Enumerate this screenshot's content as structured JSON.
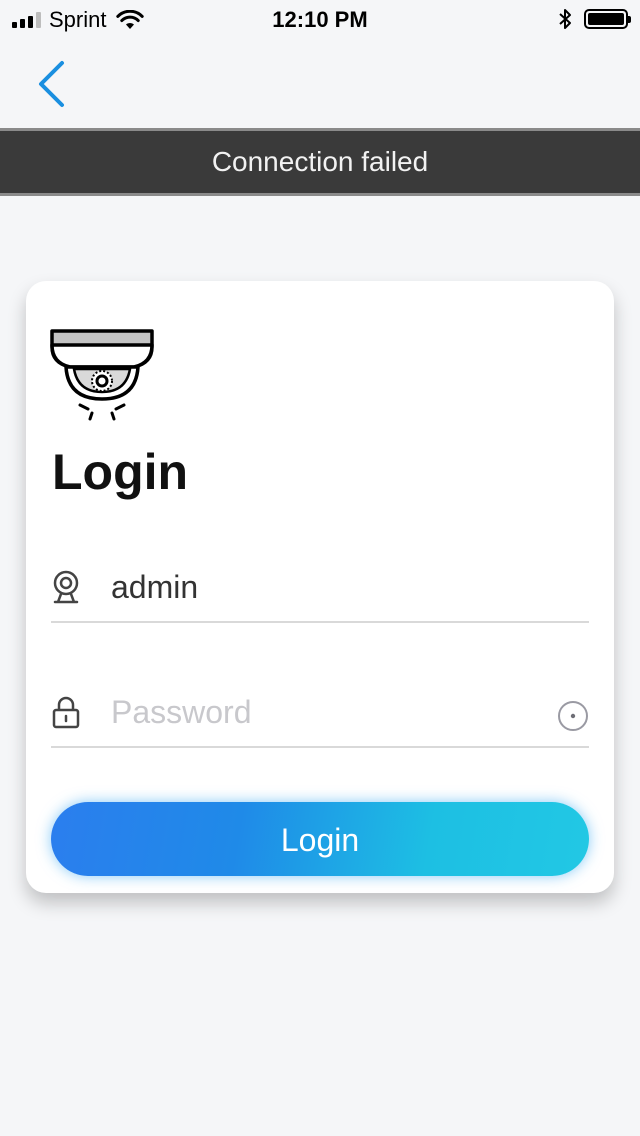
{
  "status_bar": {
    "carrier": "Sprint",
    "time": "12:10 PM",
    "signal_bars_filled": 3,
    "signal_bars_total": 4
  },
  "nav": {
    "back_icon": "chevron-left-icon",
    "accent_color": "#1a8fe0"
  },
  "banner": {
    "message": "Connection failed"
  },
  "login_card": {
    "logo_icon": "dome-camera-icon",
    "title": "Login",
    "username": {
      "icon": "webcam-icon",
      "value": "admin"
    },
    "password": {
      "icon": "lock-icon",
      "placeholder": "Password",
      "value": "",
      "toggle_icon": "show-password-icon"
    },
    "submit_label": "Login"
  }
}
